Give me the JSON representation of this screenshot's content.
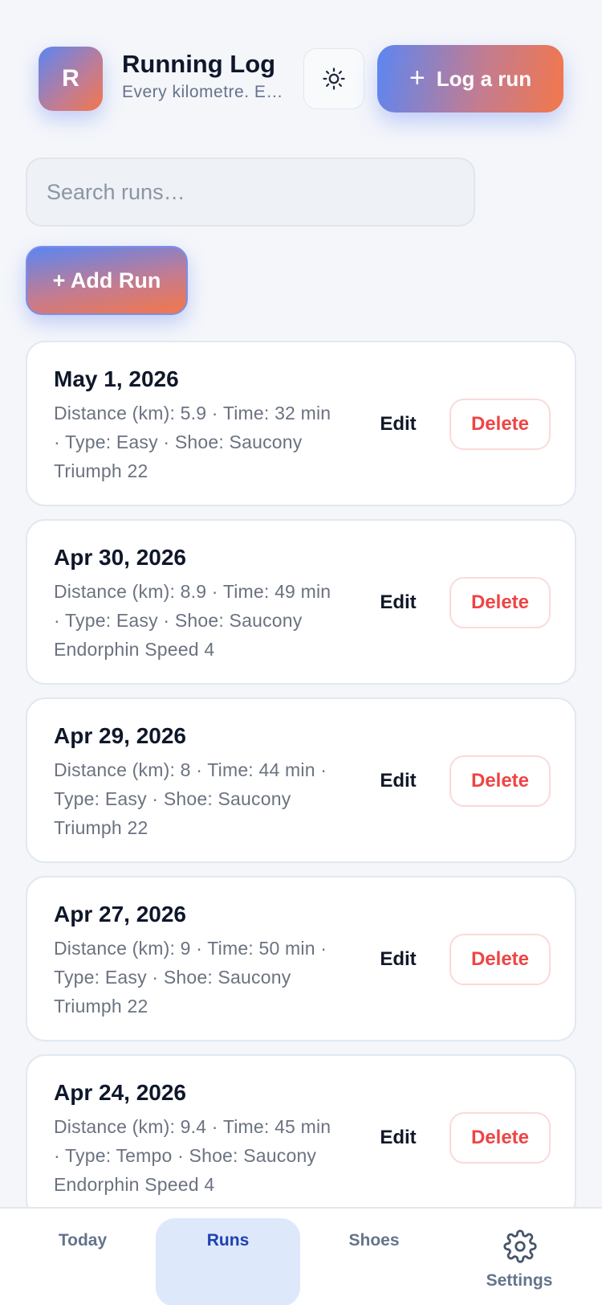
{
  "header": {
    "avatar_initial": "R",
    "title": "Running Log",
    "subtitle": "Every kilometre. Every shoe.",
    "theme_icon": "sun-icon",
    "log_button_label": "Log a run"
  },
  "search": {
    "placeholder": "Search runs…"
  },
  "add_button_label": "+ Add Run",
  "runs": [
    {
      "date": "May 1, 2026",
      "details": "Distance (km): 5.9 · Time: 32 min · Type: Easy · Shoe: Saucony Triumph 22",
      "edit": "Edit",
      "delete": "Delete"
    },
    {
      "date": "Apr 30, 2026",
      "details": "Distance (km): 8.9 · Time: 49 min · Type: Easy · Shoe: Saucony Endorphin Speed 4",
      "edit": "Edit",
      "delete": "Delete"
    },
    {
      "date": "Apr 29, 2026",
      "details": "Distance (km): 8 · Time: 44 min · Type: Easy · Shoe: Saucony Triumph 22",
      "edit": "Edit",
      "delete": "Delete"
    },
    {
      "date": "Apr 27, 2026",
      "details": "Distance (km): 9 · Time: 50 min · Type: Easy · Shoe: Saucony Triumph 22",
      "edit": "Edit",
      "delete": "Delete"
    },
    {
      "date": "Apr 24, 2026",
      "details": "Distance (km): 9.4 · Time: 45 min · Type: Tempo · Shoe: Saucony Endorphin Speed 4",
      "edit": "Edit",
      "delete": "Delete"
    }
  ],
  "nav": {
    "today": "Today",
    "runs": "Runs",
    "shoes": "Shoes",
    "settings": "Settings",
    "active": "runs"
  },
  "colors": {
    "accent_blue": "#5b86f2",
    "accent_orange": "#f3774a",
    "danger": "#ef4444",
    "active_tab_bg": "#dde8fb"
  }
}
